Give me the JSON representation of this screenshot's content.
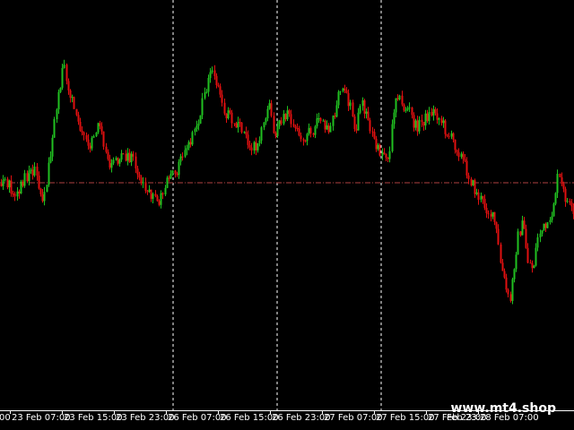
{
  "chart_data": {
    "type": "candlestick",
    "x_tick_labels": [
      "23 Feb 07:00",
      "23 Feb 15:00",
      "23 Feb 23:00",
      "26 Feb 07:00",
      "26 Feb 15:00",
      "26 Feb 23:00",
      "27 Feb 07:00",
      "27 Feb 15:00",
      "27 Feb 23:00",
      "28 Feb 07:00"
    ],
    "x_tick_label_partial_left": "00",
    "x_tick_label_partial_right": "Feb 23:",
    "period_separators_after_labels": [
      "23 Feb 23:00",
      "26 Feb 15:00",
      "27 Feb 07:00"
    ],
    "y_range": [
      0,
      480
    ],
    "grid": false,
    "colors": {
      "background": "#000000",
      "bull": "#21c021",
      "bear": "#e01010",
      "separator": "#ffffff",
      "bid_line": "#b04040",
      "axis": "#ffffff",
      "text": "#ffffff"
    },
    "bid_level": 204,
    "anchors": [
      [
        0,
        205
      ],
      [
        10,
        208
      ],
      [
        20,
        215
      ],
      [
        30,
        195
      ],
      [
        38,
        188
      ],
      [
        46,
        228
      ],
      [
        52,
        200
      ],
      [
        60,
        140
      ],
      [
        68,
        85
      ],
      [
        72,
        75
      ],
      [
        78,
        110
      ],
      [
        85,
        125
      ],
      [
        92,
        155
      ],
      [
        100,
        162
      ],
      [
        108,
        140
      ],
      [
        115,
        158
      ],
      [
        122,
        186
      ],
      [
        130,
        182
      ],
      [
        140,
        172
      ],
      [
        150,
        182
      ],
      [
        160,
        208
      ],
      [
        168,
        215
      ],
      [
        175,
        226
      ],
      [
        180,
        218
      ],
      [
        186,
        198
      ],
      [
        195,
        196
      ],
      [
        205,
        170
      ],
      [
        215,
        150
      ],
      [
        222,
        128
      ],
      [
        230,
        95
      ],
      [
        236,
        80
      ],
      [
        243,
        100
      ],
      [
        250,
        125
      ],
      [
        258,
        133
      ],
      [
        265,
        140
      ],
      [
        272,
        148
      ],
      [
        280,
        165
      ],
      [
        287,
        160
      ],
      [
        295,
        130
      ],
      [
        300,
        118
      ],
      [
        306,
        150
      ],
      [
        312,
        132
      ],
      [
        320,
        128
      ],
      [
        330,
        145
      ],
      [
        340,
        152
      ],
      [
        350,
        145
      ],
      [
        358,
        128
      ],
      [
        365,
        146
      ],
      [
        372,
        130
      ],
      [
        378,
        98
      ],
      [
        384,
        106
      ],
      [
        390,
        118
      ],
      [
        396,
        148
      ],
      [
        402,
        112
      ],
      [
        408,
        128
      ],
      [
        414,
        148
      ],
      [
        420,
        168
      ],
      [
        428,
        170
      ],
      [
        434,
        175
      ],
      [
        438,
        125
      ],
      [
        442,
        100
      ],
      [
        448,
        120
      ],
      [
        456,
        122
      ],
      [
        462,
        142
      ],
      [
        468,
        138
      ],
      [
        476,
        130
      ],
      [
        484,
        123
      ],
      [
        492,
        136
      ],
      [
        498,
        148
      ],
      [
        505,
        158
      ],
      [
        512,
        170
      ],
      [
        520,
        190
      ],
      [
        530,
        215
      ],
      [
        538,
        226
      ],
      [
        546,
        238
      ],
      [
        552,
        250
      ],
      [
        558,
        296
      ],
      [
        563,
        318
      ],
      [
        568,
        340
      ],
      [
        574,
        286
      ],
      [
        578,
        260
      ],
      [
        583,
        250
      ],
      [
        588,
        290
      ],
      [
        594,
        300
      ],
      [
        600,
        260
      ],
      [
        606,
        255
      ],
      [
        612,
        255
      ],
      [
        617,
        225
      ],
      [
        622,
        196
      ],
      [
        628,
        215
      ],
      [
        635,
        232
      ],
      [
        640,
        245
      ]
    ]
  },
  "watermark": "www.mt4.shop"
}
